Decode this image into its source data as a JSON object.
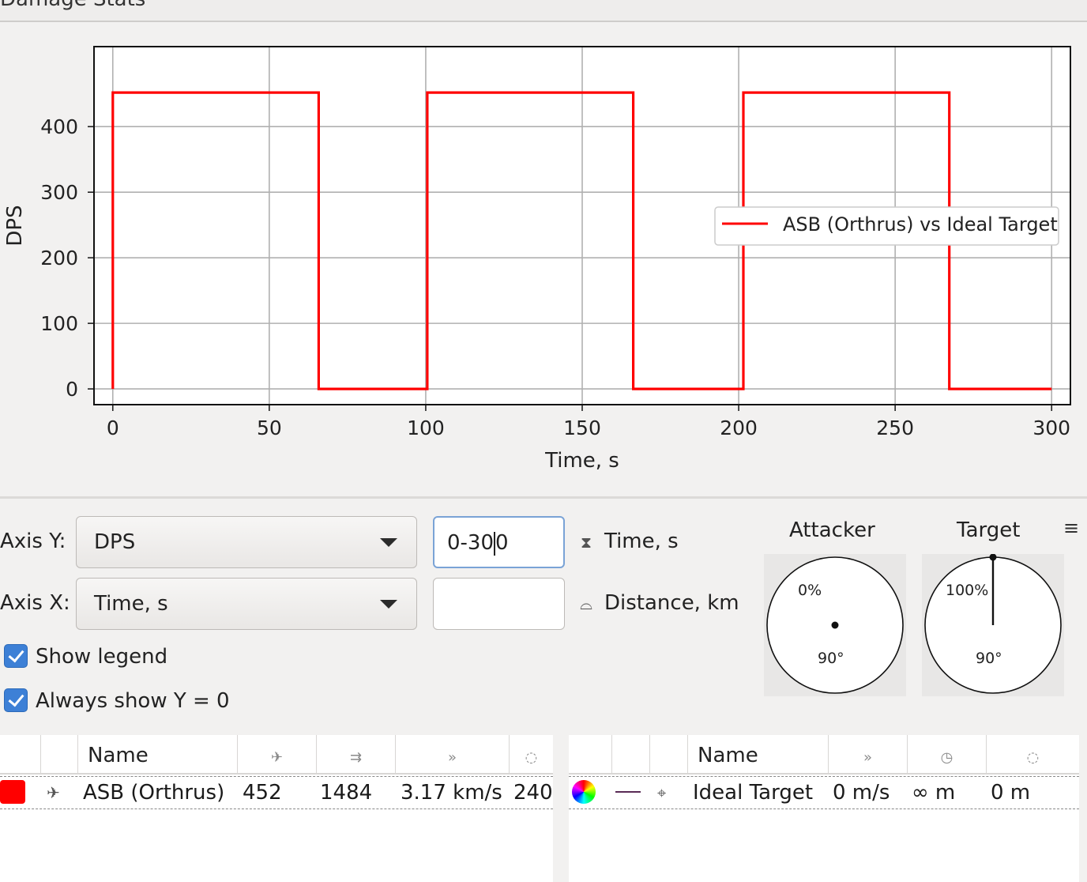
{
  "window": {
    "title": "Damage Stats"
  },
  "chart_data": {
    "type": "line",
    "xlabel": "Time, s",
    "ylabel": "DPS",
    "xlim": [
      -6,
      306
    ],
    "ylim": [
      -24,
      522
    ],
    "x_ticks": [
      0,
      50,
      100,
      150,
      200,
      250,
      300
    ],
    "y_ticks": [
      0,
      100,
      200,
      300,
      400
    ],
    "grid": true,
    "legend_position": "right",
    "series": [
      {
        "name": "ASB (Orthrus) vs Ideal Target",
        "color": "#ff0000",
        "step": true,
        "x": [
          0,
          0,
          65.8,
          65.8,
          100.5,
          100.5,
          166.3,
          166.3,
          201.5,
          201.5,
          267.3,
          267.3,
          300
        ],
        "y": [
          0,
          452,
          452,
          0,
          0,
          452,
          452,
          0,
          0,
          452,
          452,
          0,
          0
        ]
      }
    ]
  },
  "controls": {
    "axis_y_label": "Axis Y:",
    "axis_y_value": "DPS",
    "axis_x_label": "Axis X:",
    "axis_x_value": "Time, s",
    "range_before_caret": "0-30",
    "range_after_caret": "0",
    "range_x_value": "",
    "time_label": "Time, s",
    "distance_label": "Distance, km",
    "show_legend": "Show legend",
    "always_show_y0": "Always show Y = 0",
    "time_icon": "hourglass-icon",
    "distance_icon": "distance-icon"
  },
  "dials": {
    "attacker": {
      "title": "Attacker",
      "percent": "0%",
      "angle": "90°"
    },
    "target": {
      "title": "Target",
      "percent": "100%",
      "angle": "90°"
    }
  },
  "fits_table": {
    "headers": [
      "Name"
    ],
    "header_icons": [
      "ship-icon",
      "speed-icon",
      "velocity-icon",
      "radius-icon"
    ],
    "rows": [
      {
        "color": "#ff0000",
        "icon": "ship-icon",
        "name": "ASB (Orthrus)",
        "dps": "452",
        "volley": "1484",
        "speed": "3.17 km/s",
        "sig": "240"
      }
    ]
  },
  "targets_table": {
    "headers": [
      "Name"
    ],
    "header_icons": [
      "velocity-icon",
      "clock-icon",
      "radius-icon"
    ],
    "rows": [
      {
        "color_icon": "color-wheel-icon",
        "line_icon": "line-style-icon",
        "icon": "target-icon",
        "name": "Ideal Target",
        "speed": "0 m/s",
        "sig": "∞ m",
        "radius": "0 m"
      }
    ]
  }
}
